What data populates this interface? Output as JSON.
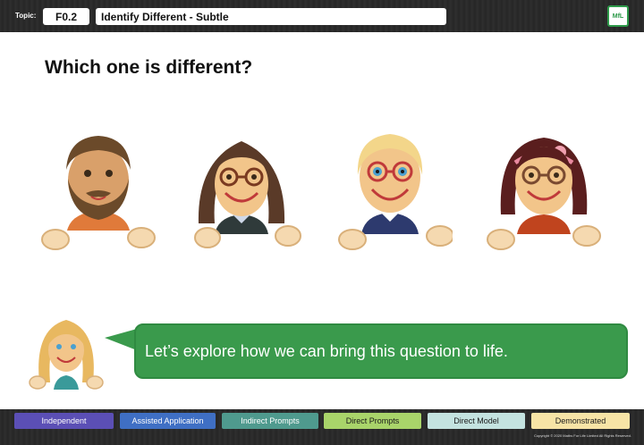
{
  "header": {
    "topic_label": "Topic:",
    "topic_code": "F0.2",
    "topic_title": "Identify Different - Subtle",
    "logo_text": "MfL"
  },
  "main": {
    "question": "Which one is different?",
    "faces": [
      {
        "name": "bearded-man",
        "hair": "#6b4a2a",
        "shirt": "#e07a3a",
        "glasses": false
      },
      {
        "name": "curly-hair-glasses",
        "hair": "#5a3a28",
        "shirt": "#2f3a3a",
        "glasses": true,
        "glasses_color": "#7a3a20"
      },
      {
        "name": "blonde-glasses",
        "hair": "#f3d68a",
        "shirt": "#2d3a6e",
        "glasses": true,
        "glasses_color": "#c03a3a",
        "eye_color": "#4aa0d0"
      },
      {
        "name": "dark-hair-headband",
        "hair": "#5a1e1e",
        "shirt": "#c0441e",
        "glasses": true,
        "glasses_color": "#7a4a30"
      }
    ],
    "bubble_text": "Let’s explore how we can bring this question to life."
  },
  "footer": {
    "levels": [
      {
        "label": "Independent",
        "bg": "#5b4fb5",
        "fg": "#ffffff"
      },
      {
        "label": "Assisted Application",
        "bg": "#3f6fc4",
        "fg": "#ffffff"
      },
      {
        "label": "Indirect Prompts",
        "bg": "#4f9a8e",
        "fg": "#ffffff"
      },
      {
        "label": "Direct Prompts",
        "bg": "#a9d46a",
        "fg": "#1a1a1a"
      },
      {
        "label": "Direct Model",
        "bg": "#c4e3e0",
        "fg": "#1a1a1a"
      },
      {
        "label": "Demonstrated",
        "bg": "#f7e4a6",
        "fg": "#1a1a1a"
      }
    ],
    "copyright": "Copyright © 2020 Maths For Life Limited All Rights Reserved."
  },
  "colors": {
    "accent_green": "#3a9a4c",
    "skin": "#f2c58a",
    "hand": "#f5d9b0"
  }
}
